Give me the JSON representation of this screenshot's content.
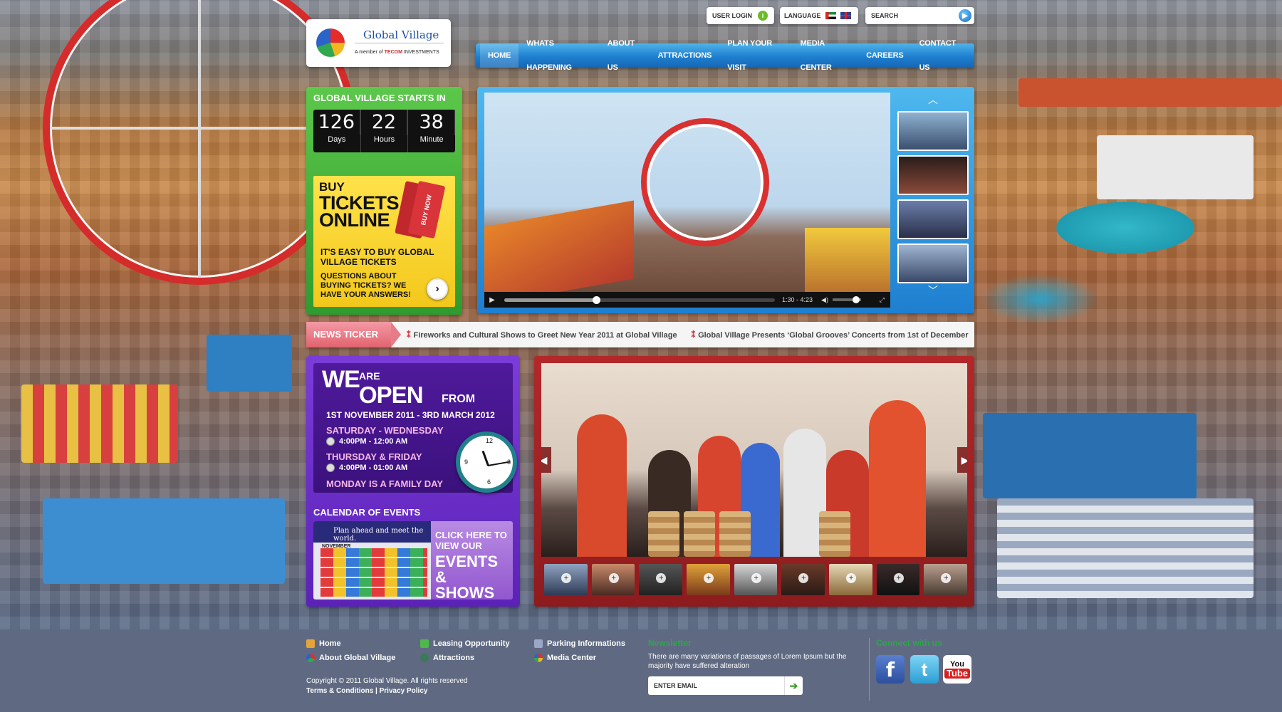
{
  "header": {
    "logo_name": "Global Village",
    "logo_sub_prefix": "A member of",
    "logo_sub_brand": "TECOM",
    "logo_sub_suffix": "INVESTMENTS",
    "user_login": "USER LOGIN",
    "language": "LANGUAGE",
    "search_placeholder": "SEARCH"
  },
  "nav": [
    "HOME",
    "WHATS HAPPENING",
    "ABOUT US",
    "ATTRACTIONS",
    "PLAN YOUR VISIT",
    "MEDIA CENTER",
    "CAREERS",
    "CONTACT US"
  ],
  "countdown": {
    "title": "GLOBAL VILLAGE STARTS IN",
    "days": "126",
    "days_label": "Days",
    "hours": "22",
    "hours_label": "Hours",
    "minutes": "38",
    "minutes_label": "Minute"
  },
  "tickets": {
    "line1": "BUY",
    "line2": "TICKETS",
    "line3": "ONLINE",
    "ticket_text": "BUY NOW",
    "para1": "IT'S EASY TO BUY GLOBAL VILLAGE TICKETS",
    "para2": "QUESTIONS ABOUT BUYING TICKETS? WE HAVE YOUR ANSWERS!"
  },
  "video": {
    "time": "1:30 - 4:23",
    "progress": 0.34
  },
  "ticker": {
    "label": "NEWS TICKER",
    "items": [
      "Fireworks and Cultural Shows to Greet New Year 2011 at Global Village",
      "Global Village Presents ‘Global Grooves’ Concerts from 1st of December"
    ]
  },
  "open": {
    "we": "WE",
    "are": "ARE",
    "open": "OPEN",
    "from": "FROM",
    "dates": "1ST NOVEMBER 2011 - 3RD MARCH 2012",
    "days1": "SATURDAY - WEDNESDAY",
    "hours1": "4:00PM - 12:00 AM",
    "days2": "THURSDAY & FRIDAY",
    "hours2": "4:00PM - 01:00 AM",
    "family": "MONDAY IS A FAMILY DAY"
  },
  "calendar": {
    "title": "CALENDAR OF EVENTS",
    "banner": "Plan ahead and meet the world.",
    "month": "NOVEMBER",
    "cta1": "CLICK HERE TO VIEW OUR",
    "cta2": "EVENTS & SHOWS"
  },
  "footer": {
    "links": [
      "Home",
      "About Global Village",
      "Leasing Opportunity",
      "Attractions",
      "Parking Informations",
      "Media Center"
    ],
    "copyright": "Copyright © 2011 Global Village. All rights reserved",
    "terms": "Terms & Conditions",
    "privacy": "Privacy Policy",
    "newsletter_title": "Newsletter",
    "newsletter_text": "There are many variations of passages of Lorem Ipsum but the majority have suffered alteration",
    "email_placeholder": "ENTER EMAIL",
    "connect_title": "Connect with us",
    "youtube_you": "You",
    "youtube_tube": "Tube"
  },
  "colors": {
    "nav_blue": "#1e7fcf",
    "green_panel": "#2f9b2f",
    "purple_panel": "#5b22b8",
    "red_panel": "#8d1b1e",
    "footer_bg": "#5f6a82",
    "accent_green": "#2aa84a"
  }
}
